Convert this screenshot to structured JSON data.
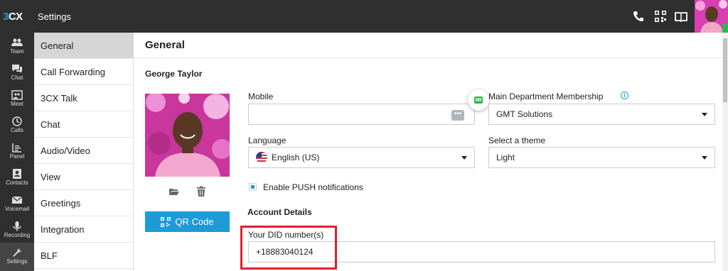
{
  "app": {
    "logo_3": "3",
    "logo_cx": "CX",
    "title": "Settings"
  },
  "rail": [
    {
      "label": "Team",
      "icon": "team-icon"
    },
    {
      "label": "Chat",
      "icon": "chat-icon"
    },
    {
      "label": "Meet",
      "icon": "meet-icon"
    },
    {
      "label": "Calls",
      "icon": "calls-icon"
    },
    {
      "label": "Panel",
      "icon": "panel-icon"
    },
    {
      "label": "Contacts",
      "icon": "contacts-icon"
    },
    {
      "label": "Voicemail",
      "icon": "voicemail-icon"
    },
    {
      "label": "Recording",
      "icon": "microphone-icon"
    },
    {
      "label": "Settings",
      "icon": "wrench-icon"
    }
  ],
  "nav": [
    {
      "label": "General",
      "active": true
    },
    {
      "label": "Call Forwarding"
    },
    {
      "label": "3CX Talk"
    },
    {
      "label": "Chat"
    },
    {
      "label": "Audio/Video"
    },
    {
      "label": "View"
    },
    {
      "label": "Greetings"
    },
    {
      "label": "Integration"
    },
    {
      "label": "BLF"
    }
  ],
  "content": {
    "title": "General",
    "user_name": "George Taylor",
    "qr_button": "QR Code",
    "mobile": {
      "label": "Mobile",
      "value": ""
    },
    "department": {
      "label": "Main Department Membership",
      "value": "GMT Solutions"
    },
    "language": {
      "label": "Language",
      "value": "English (US)"
    },
    "theme": {
      "label": "Select a theme",
      "value": "Light"
    },
    "push": {
      "label": "Enable PUSH notifications",
      "checked": true
    },
    "account_title": "Account Details",
    "did": {
      "label": "Your DID number(s)",
      "value": "+18883040124"
    }
  },
  "colors": {
    "accent": "#1e9bd7",
    "topbar": "#2f2f2f",
    "highlight": "#e0212b",
    "status": "#2db84d"
  }
}
